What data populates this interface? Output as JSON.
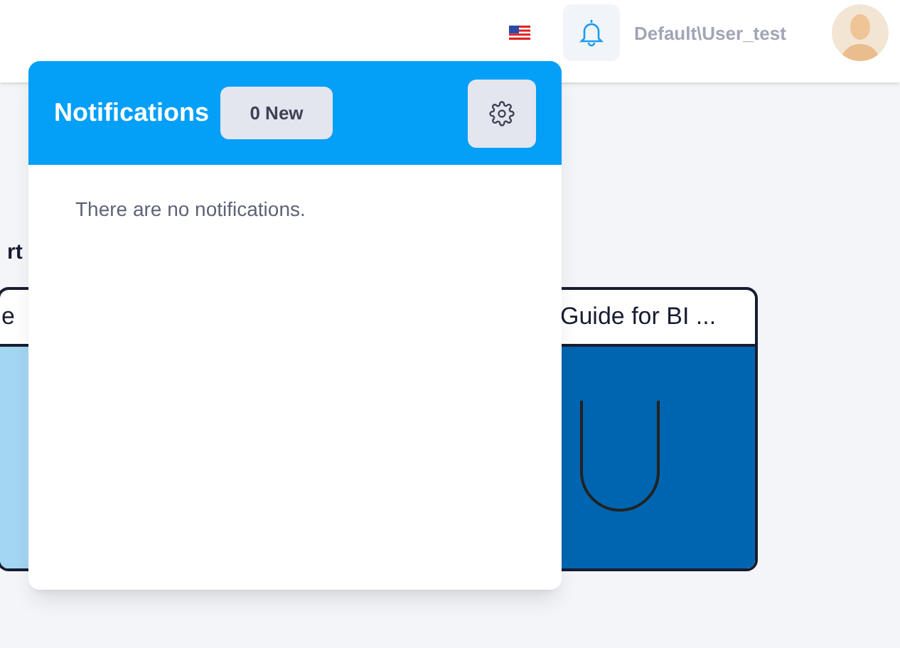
{
  "header": {
    "user": "Default\\User_test"
  },
  "background": {
    "section_heading": "rt",
    "cards": [
      {
        "title": "e",
        "color": "#a3d6f1"
      },
      {
        "title": "Guide for BI ...",
        "color": "#0065b0"
      }
    ]
  },
  "notifications": {
    "title": "Notifications",
    "badge": "0 New",
    "empty_message": "There are no notifications."
  }
}
